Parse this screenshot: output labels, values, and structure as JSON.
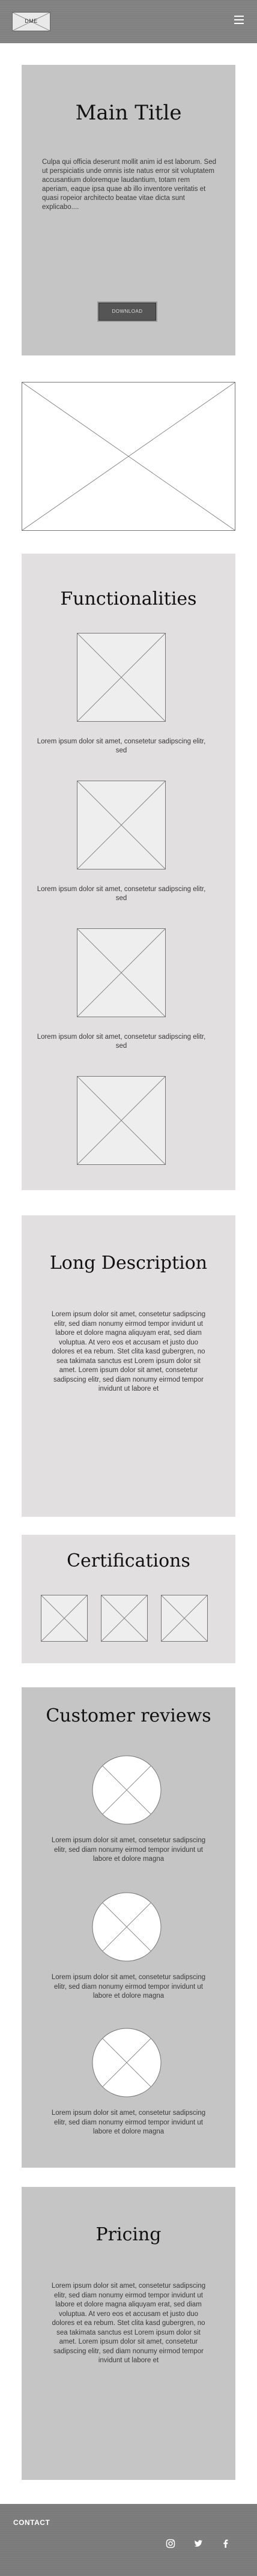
{
  "header": {
    "logo_text": "DME",
    "menu_icon": "hamburger-menu-icon"
  },
  "hero": {
    "title": "Main Title",
    "text": "Culpa qui officia deserunt mollit anim id est laborum. Sed ut perspiciatis unde omnis iste natus error sit voluptatem accusantium doloremque laudantium, totam rem aperiam, eaque ipsa quae ab illo inventore veritatis et quasi ropeior architecto beatae vitae dicta sunt explicabo....",
    "button_label": "DOWNLOAD"
  },
  "functionalities": {
    "title": "Functionalities",
    "items": [
      {
        "text": "Lorem ipsum dolor sit amet, consetetur sadipscing elitr, sed"
      },
      {
        "text": "Lorem ipsum dolor sit amet, consetetur sadipscing elitr, sed"
      },
      {
        "text": "Lorem ipsum dolor sit amet, consetetur sadipscing elitr, sed"
      }
    ]
  },
  "long_description": {
    "title": "Long Description",
    "text": "Lorem ipsum dolor sit amet, consetetur sadipscing elitr, sed diam nonumy eirmod tempor invidunt ut labore et dolore magna aliquyam erat, sed diam voluptua. At vero eos et accusam et justo duo dolores et ea rebum. Stet clita kasd gubergren, no sea takimata sanctus est Lorem ipsum dolor sit amet. Lorem ipsum dolor sit amet, consetetur sadipscing elitr, sed diam nonumy eirmod tempor invidunt ut labore et"
  },
  "certifications": {
    "title": "Certifications"
  },
  "reviews": {
    "title": "Customer reviews",
    "items": [
      {
        "text": "Lorem ipsum dolor sit amet, consetetur sadipscing elitr, sed diam nonumy eirmod tempor invidunt ut labore et dolore magna"
      },
      {
        "text": "Lorem ipsum dolor sit amet, consetetur sadipscing elitr, sed diam nonumy eirmod tempor invidunt ut labore et dolore magna"
      },
      {
        "text": "Lorem ipsum dolor sit amet, consetetur sadipscing elitr, sed diam nonumy eirmod tempor invidunt ut labore et dolore magna"
      }
    ]
  },
  "pricing": {
    "title": "Pricing",
    "text": "Lorem ipsum dolor sit amet, consetetur sadipscing elitr, sed diam nonumy eirmod tempor invidunt ut labore et dolore magna aliquyam erat, sed diam voluptua. At vero eos et accusam et justo duo dolores et ea rebum. Stet clita kasd gubergren, no sea takimata sanctus est Lorem ipsum dolor sit amet. Lorem ipsum dolor sit amet, consetetur sadipscing elitr, sed diam nonumy eirmod tempor invidunt ut labore et"
  },
  "footer": {
    "contact_label": "CONTACT",
    "social_icons": [
      "instagram-icon",
      "twitter-icon",
      "facebook-icon"
    ]
  }
}
